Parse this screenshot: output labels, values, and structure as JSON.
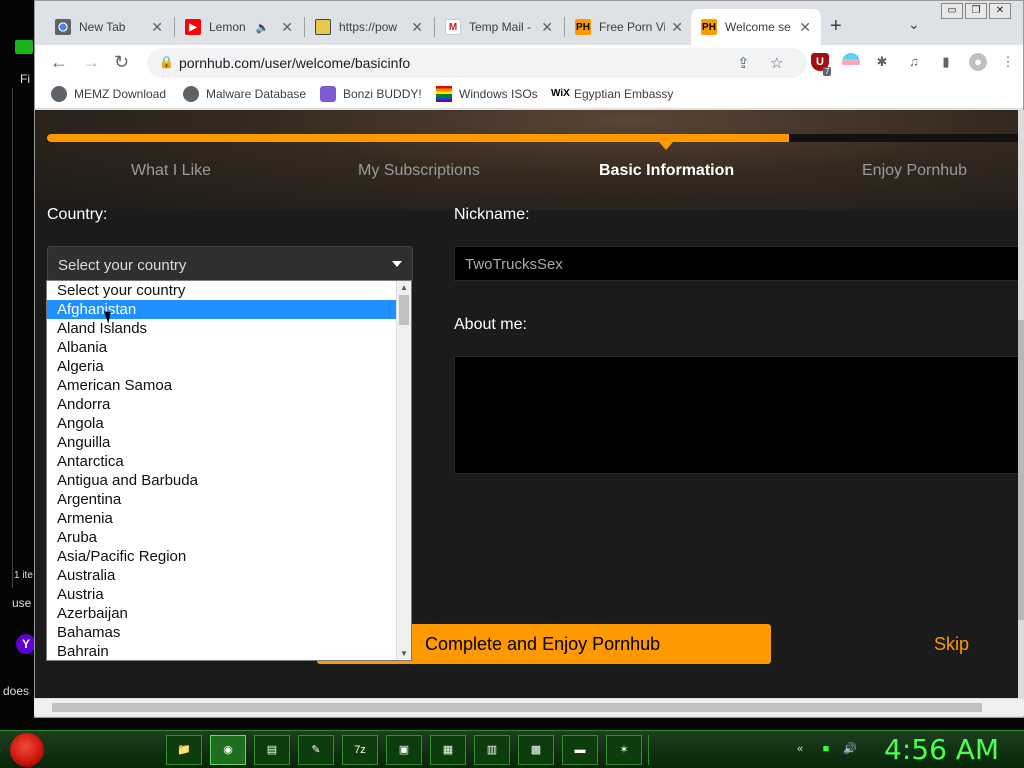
{
  "desktop": {
    "fi_label": "Fi",
    "items_label": "1 ite",
    "use_label": "use",
    "does_label": "does",
    "yahoo_glyph": "Y"
  },
  "tabs": [
    {
      "title": "New Tab",
      "icon": "chrome-icon"
    },
    {
      "title": "Lemon",
      "icon": "youtube-icon",
      "audio": "🔈"
    },
    {
      "title": "https://pow",
      "icon": "image-icon"
    },
    {
      "title": "Temp Mail -",
      "icon": "gmail-icon"
    },
    {
      "title": "Free Porn Vi",
      "icon": "ph-icon",
      "glyph": "PH"
    },
    {
      "title": "Welcome se",
      "icon": "ph-icon",
      "glyph": "PH",
      "active": true
    }
  ],
  "tab_controls": {
    "close": "✕",
    "new_tab": "+",
    "tab_search": "⌄"
  },
  "window_controls": {
    "minimize": "▭",
    "restore": "❐",
    "close": "✕"
  },
  "toolbar": {
    "back": "←",
    "forward": "→",
    "reload": "↻",
    "lock": "🔒",
    "url": "pornhub.com/user/welcome/basicinfo",
    "share": "⇪",
    "star": "☆",
    "ext_badge": "7",
    "puzzle": "✱",
    "media": "♫",
    "sidebar": "▮",
    "profile": "●",
    "menu": "⋮"
  },
  "bookmarks": [
    {
      "label": "MEMZ Download",
      "icon": "globe-icon"
    },
    {
      "label": "Malware Database",
      "icon": "globe-icon"
    },
    {
      "label": "Bonzi BUDDY!",
      "icon": "bonzi-icon"
    },
    {
      "label": "Windows ISOs",
      "icon": "rainbow-icon"
    },
    {
      "label": "Egyptian Embassy",
      "icon": "wix-icon",
      "glyph": "WiX"
    }
  ],
  "steps": [
    "What I Like",
    "My Subscriptions",
    "Basic Information",
    "Enjoy Pornhub"
  ],
  "active_step": 2,
  "progress_fraction": 0.76,
  "form": {
    "country_label": "Country:",
    "country_placeholder": "Select your country",
    "nickname_label": "Nickname:",
    "nickname_value": "TwoTrucksSex",
    "about_label": "About me:",
    "complete_button": "Complete and Enjoy Pornhub",
    "skip_link": "Skip"
  },
  "country_options": [
    "Select your country",
    "Afghanistan",
    "Aland Islands",
    "Albania",
    "Algeria",
    "American Samoa",
    "Andorra",
    "Angola",
    "Anguilla",
    "Antarctica",
    "Antigua and Barbuda",
    "Argentina",
    "Armenia",
    "Aruba",
    "Asia/Pacific Region",
    "Australia",
    "Austria",
    "Azerbaijan",
    "Bahamas",
    "Bahrain"
  ],
  "highlighted_option": 1,
  "taskbar": {
    "apps": [
      "📁",
      "◉",
      "▤",
      "✎",
      "7z",
      "▣",
      "▦",
      "▥",
      "▩",
      "▬",
      "✶"
    ],
    "clock": "4:56 AM"
  },
  "colors": {
    "accent": "#ff9900",
    "highlight": "#1e90ff",
    "clock": "#4cff4c"
  }
}
